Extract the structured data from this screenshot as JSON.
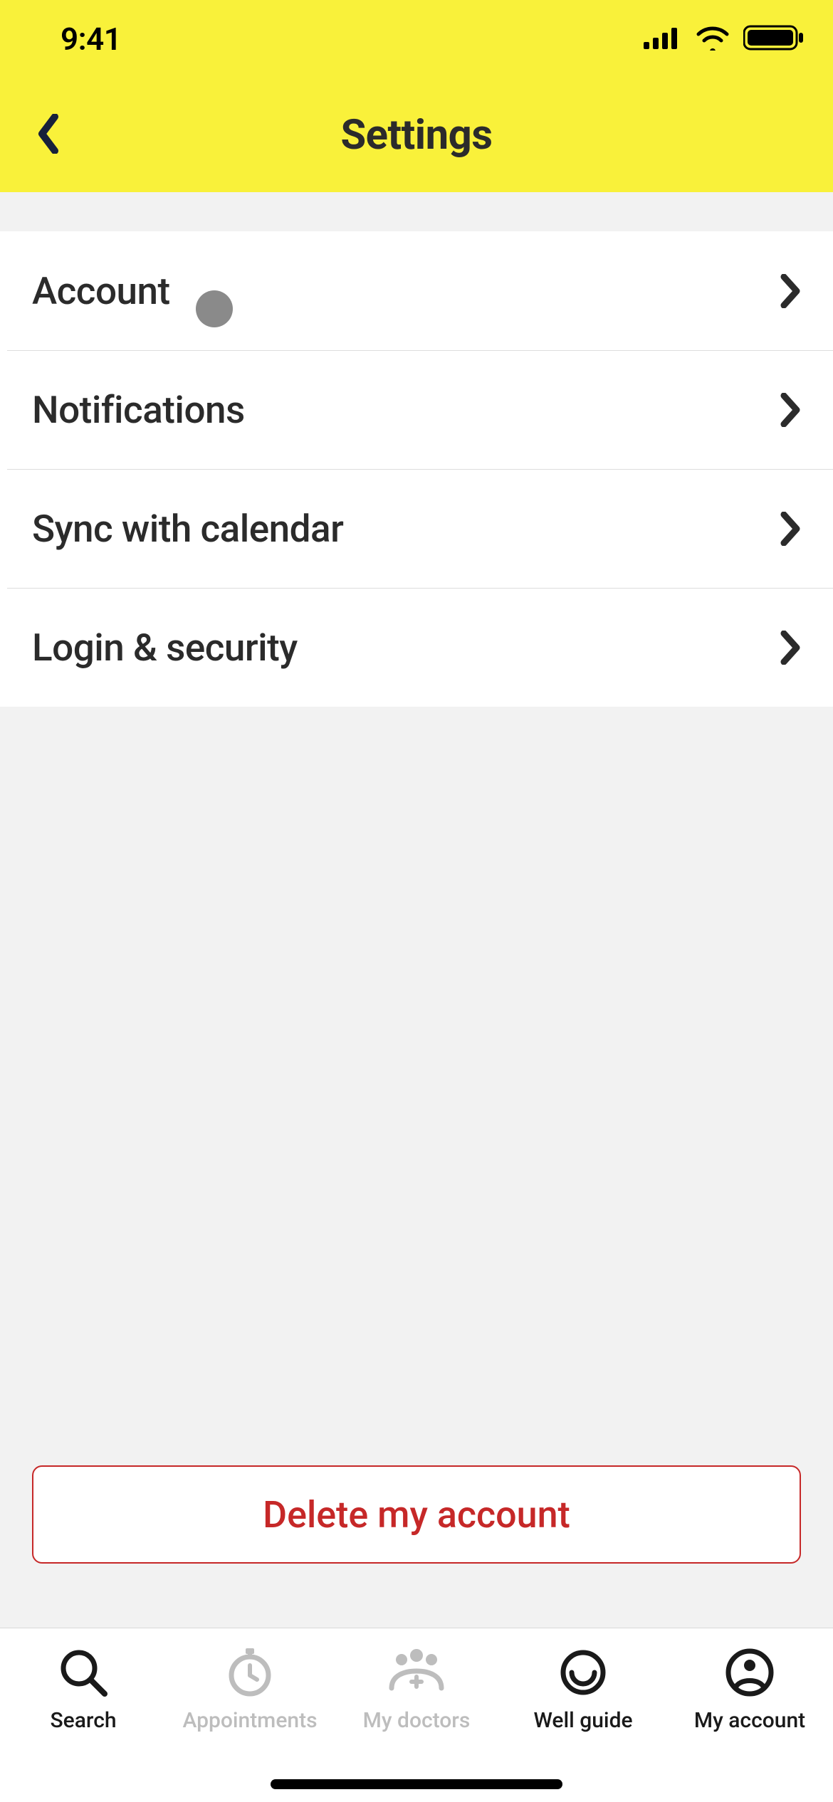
{
  "status": {
    "time": "9:41"
  },
  "header": {
    "title": "Settings"
  },
  "settings": {
    "items": [
      {
        "label": "Account"
      },
      {
        "label": "Notifications"
      },
      {
        "label": "Sync with calendar"
      },
      {
        "label": "Login & security"
      }
    ]
  },
  "actions": {
    "delete_label": "Delete my account"
  },
  "tabs": {
    "items": [
      {
        "label": "Search"
      },
      {
        "label": "Appointments"
      },
      {
        "label": "My doctors"
      },
      {
        "label": "Well guide"
      },
      {
        "label": "My account"
      }
    ],
    "active_index": 4
  }
}
